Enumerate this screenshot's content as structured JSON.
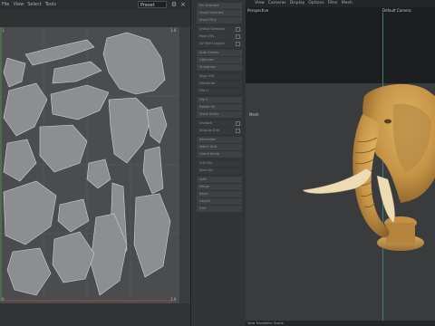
{
  "uv_editor": {
    "menu": [
      "File",
      "View",
      "Select",
      "Tools"
    ],
    "uv_set": "Preset",
    "corner_tl": "1",
    "corner_tr": "1.0",
    "corner_bl": "0",
    "corner_br": "1.0"
  },
  "side_panel": {
    "items": [
      "Pin Selected",
      "Unpin Selected",
      "Invert Pins",
      "Unfold Selected",
      "Pack UVs",
      "UV Shell Layout",
      "Auto Seams",
      "Optimize",
      "Straighten",
      "Align UVs",
      "Distribute",
      "Flip U",
      "Flip V",
      "Rotate 90",
      "Stack Shells",
      "Unstack",
      "Snap to Grid",
      "Normalize",
      "Match Grid",
      "Orient Shells",
      "Cut UVs",
      "Sew UVs",
      "Split",
      "Merge",
      "Relax",
      "Layout",
      "Grid"
    ]
  },
  "viewport": {
    "menu": [
      "View",
      "Cameras",
      "Display",
      "Options",
      "Filter",
      "Mesh"
    ],
    "perspective_label": "Perspective",
    "camera_label": "Default Camera",
    "mesh_label": "Mesh",
    "status_text": "View Transform: Scene",
    "colors": {
      "model_light": "#e0b463",
      "model_mid": "#c69447",
      "model_dark": "#8a6328",
      "background_top": "#1d1e20",
      "background_main": "#3a3b3d"
    }
  }
}
